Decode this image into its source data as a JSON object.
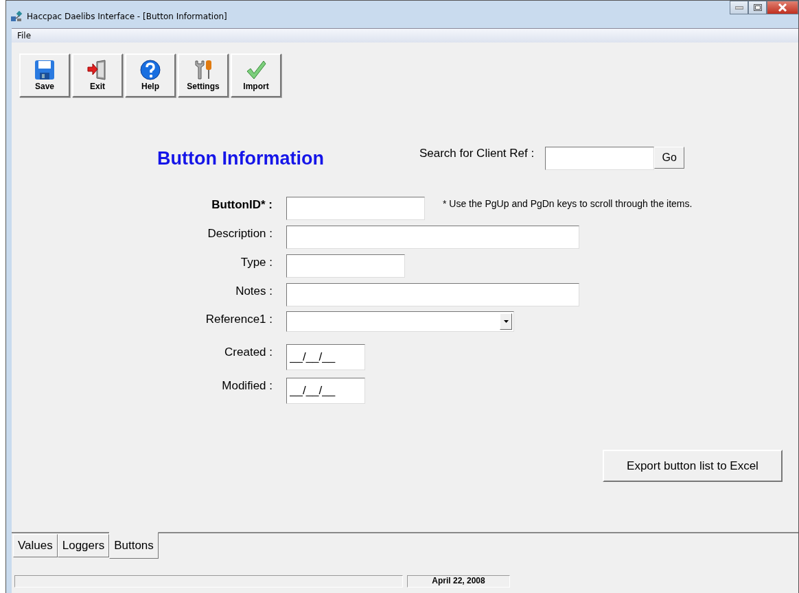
{
  "window": {
    "title": "Haccpac Daelibs Interface - [Button Information]"
  },
  "menu": [
    "File"
  ],
  "toolbar": [
    {
      "label": "Save"
    },
    {
      "label": "Exit"
    },
    {
      "label": "Help"
    },
    {
      "label": "Settings"
    },
    {
      "label": "Import"
    }
  ],
  "heading": "Button Information",
  "search": {
    "label": "Search for Client Ref :",
    "button": "Go"
  },
  "fields": [
    {
      "label": "ButtonID* :",
      "kind": "text",
      "bold": true,
      "note": "* Use the PgUp and PgDn keys to scroll through the items."
    },
    {
      "label": "Description :",
      "kind": "text",
      "bold": false
    },
    {
      "label": "Type :",
      "kind": "text",
      "bold": false
    },
    {
      "label": "Notes :",
      "kind": "text",
      "bold": false
    },
    {
      "label": "Reference1 :",
      "kind": "combo",
      "bold": false
    },
    {
      "label": "Created :",
      "kind": "date",
      "bold": false,
      "value": "__/__/__"
    },
    {
      "label": "Modified :",
      "kind": "date",
      "bold": false,
      "value": "__/__/__"
    }
  ],
  "export_button": "Export button list to Excel",
  "tabs": [
    {
      "label": "Values",
      "selected": false
    },
    {
      "label": "Loggers",
      "selected": false
    },
    {
      "label": "Buttons",
      "selected": true
    }
  ],
  "status_bar": {
    "date": "April 22, 2008"
  }
}
